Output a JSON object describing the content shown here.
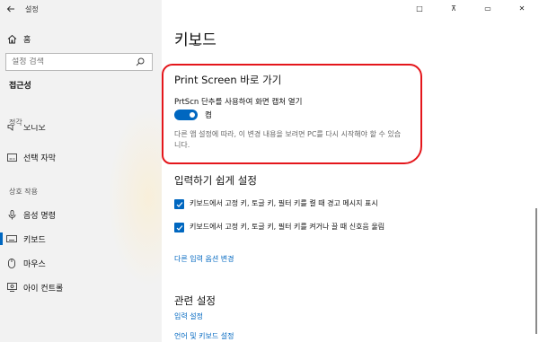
{
  "app": {
    "title": "설정"
  },
  "window_controls": {
    "minimize": "□",
    "pin": "⊼",
    "maximize": "▭",
    "close": "✕"
  },
  "sidebar": {
    "home_label": "홈",
    "search_placeholder": "설정 검색",
    "section_title": "접근성",
    "groups": [
      {
        "label": "정각",
        "items": [
          {
            "label": "오디오"
          },
          {
            "label": "선택 자막"
          }
        ]
      },
      {
        "label": "상호 작용",
        "items": [
          {
            "label": "음성 명령"
          },
          {
            "label": "키보드"
          },
          {
            "label": "마우스"
          },
          {
            "label": "아이 컨트롤"
          }
        ]
      }
    ]
  },
  "main": {
    "page_title": "키보드",
    "print_screen": {
      "title": "Print Screen 바로 가기",
      "option_label": "PrtScn 단추를 사용하여 화면 캡처 열기",
      "toggle_state": "켬",
      "note": "다른 앱 설정에 따라, 이 변경 내용을 보려면 PC를 다시 시작해야 할 수 있습니다."
    },
    "easy_input": {
      "title": "입력하기 쉽게 설정",
      "checkboxes": [
        {
          "label": "키보드에서 고정 키, 토글 키, 필터 키를 켤 때 경고 메시지 표시"
        },
        {
          "label": "키보드에서 고정 키, 토글 키, 필터 키를 켜거나 끌 때 신호음 울림"
        }
      ],
      "link": "다른 입력 옵션 변경"
    },
    "related": {
      "title": "관련 설정",
      "links": [
        "입력 설정",
        "언어 및 키보드 설정"
      ]
    }
  },
  "colors": {
    "accent": "#0067c0",
    "highlight": "#e4161b",
    "sidebar_bg": "#f2f2f2"
  }
}
